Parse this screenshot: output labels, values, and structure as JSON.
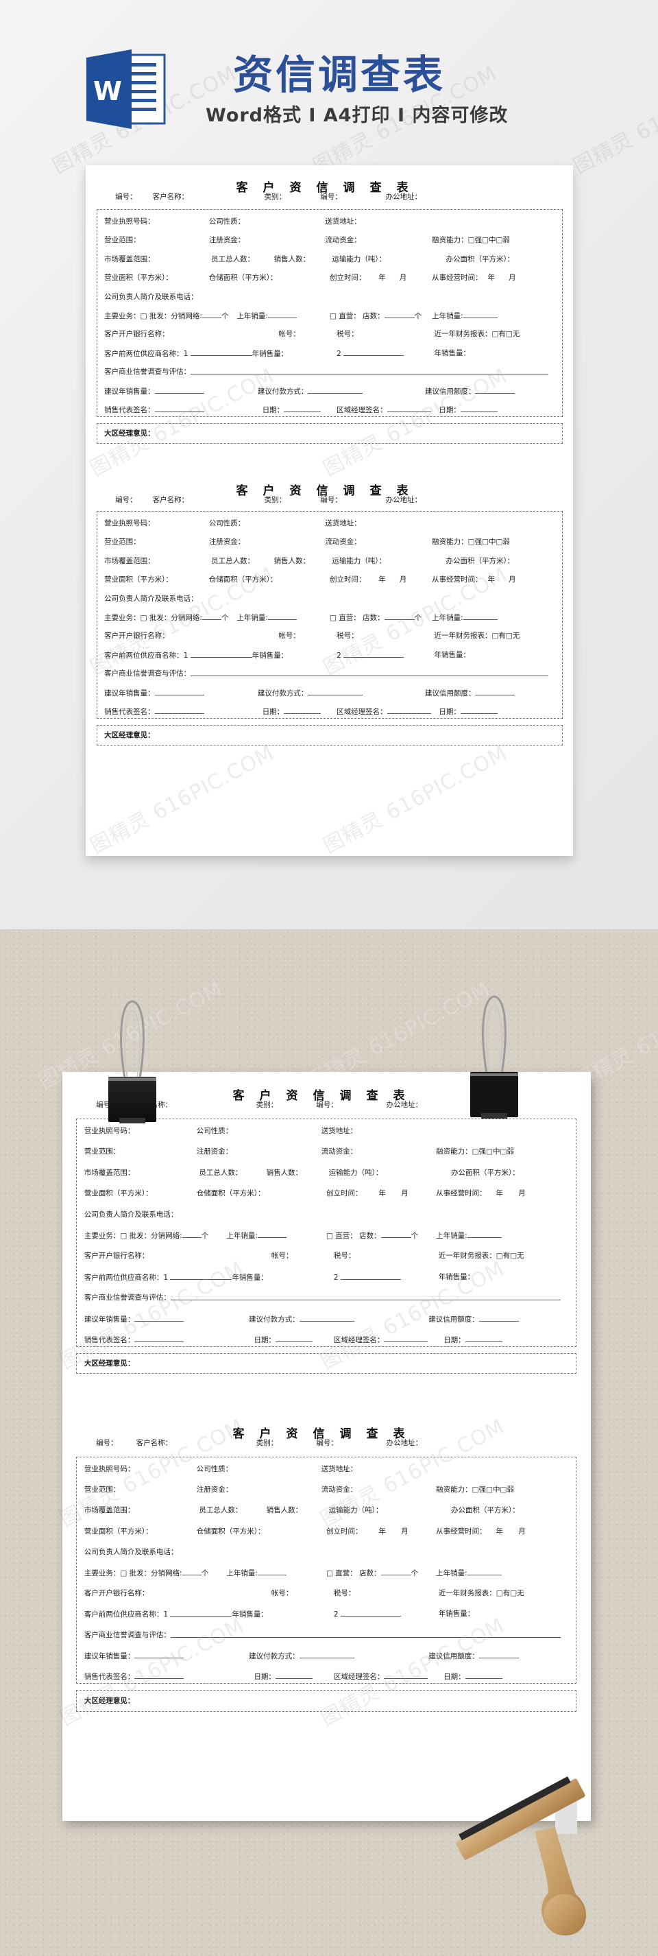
{
  "header": {
    "app_icon": "word-document-icon",
    "app_icon_letter": "W",
    "title": "资信调查表",
    "subtitle": "Word格式 I A4打印 I 内容可修改",
    "title_color": "#2b4f98"
  },
  "watermark": {
    "text": "图精灵 616PIC.COM"
  },
  "form": {
    "title": "客户资信调查表",
    "head": {
      "number_label": "编号：",
      "customer_name_label": "客户名称：",
      "category_label": "类别：",
      "number2_label": "编号：",
      "office_address_label": "办公地址："
    },
    "rows": {
      "business_license": "营业执照号码：",
      "company_type": "公司性质：",
      "delivery_address": "送货地址：",
      "business_scope": "营业范围：",
      "registered_capital": "注册资金：",
      "working_capital": "流动资金：",
      "financing_ability": "融资能力：□强□中□弱",
      "market_coverage": "市场覆盖范围：",
      "total_staff": "员工总人数：",
      "sales_staff": "销售人数：",
      "transport_capacity": "运输能力（吨）：",
      "office_area": "办公面积（平方米）：",
      "business_area": "营业面积（平方米）：",
      "storage_area": "仓储面积（平方米）：",
      "founded_label": "创立时间：",
      "year": "年",
      "month": "月",
      "operating_time_label": "从事经营时间：",
      "principal_contact": "公司负责人简介及联系电话：",
      "main_business_label": "主要业务：□ 批发：分销网络:",
      "unit_ge": "个",
      "last_year_sales": "上年销量:",
      "direct_store_label": "□ 直营： 店数：",
      "bank_name": "客户开户银行名称：",
      "account_no": "帐号：",
      "tax_no": "税号：",
      "financial_report": "近一年财务报表：□有□无",
      "supplier_label": "客户前两位供应商名称：1",
      "annual_sales": "年销售量：",
      "supplier_two": "2",
      "credit_evaluation": "客户商业信誉调查与评估：",
      "suggested_sales": "建议年销售量：",
      "suggested_payment": "建议付款方式：",
      "suggested_credit": "建议信用额度：",
      "sales_rep_signature": "销售代表签名：",
      "date": "日期：",
      "regional_manager_signature": "区域经理签名："
    },
    "manager_opinion": "大区经理意见："
  }
}
